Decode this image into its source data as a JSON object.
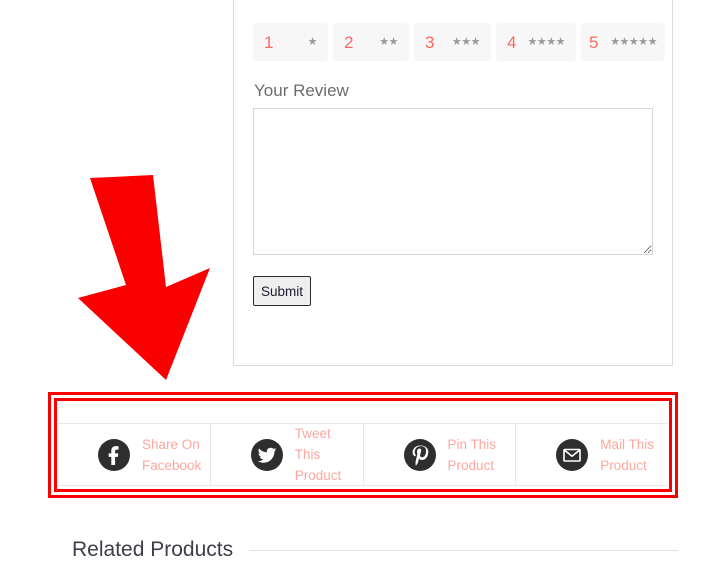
{
  "review_form": {
    "ratings": [
      {
        "value": "1",
        "stars": "★"
      },
      {
        "value": "2",
        "stars": "★★"
      },
      {
        "value": "3",
        "stars": "★★★"
      },
      {
        "value": "4",
        "stars": "★★★★"
      },
      {
        "value": "5",
        "stars": "★★★★★"
      }
    ],
    "review_label": "Your Review",
    "review_value": "",
    "review_placeholder": "",
    "submit_label": "Submit"
  },
  "share_bar": {
    "items": [
      {
        "icon": "facebook-icon",
        "label": "Share On Facebook"
      },
      {
        "icon": "twitter-icon",
        "label": "Tweet This Product"
      },
      {
        "icon": "pinterest-icon",
        "label": "Pin This Product"
      },
      {
        "icon": "mail-icon",
        "label": "Mail This Product"
      }
    ]
  },
  "related": {
    "title": "Related Products"
  },
  "annotations": {
    "arrow_color": "#fb0000",
    "box_color": "#fb0000"
  },
  "colors": {
    "accent_red": "#fa6a62",
    "share_text": "#fda8a0",
    "star_gray": "#9a9a9a",
    "icon_bg": "#2e2e2e"
  }
}
